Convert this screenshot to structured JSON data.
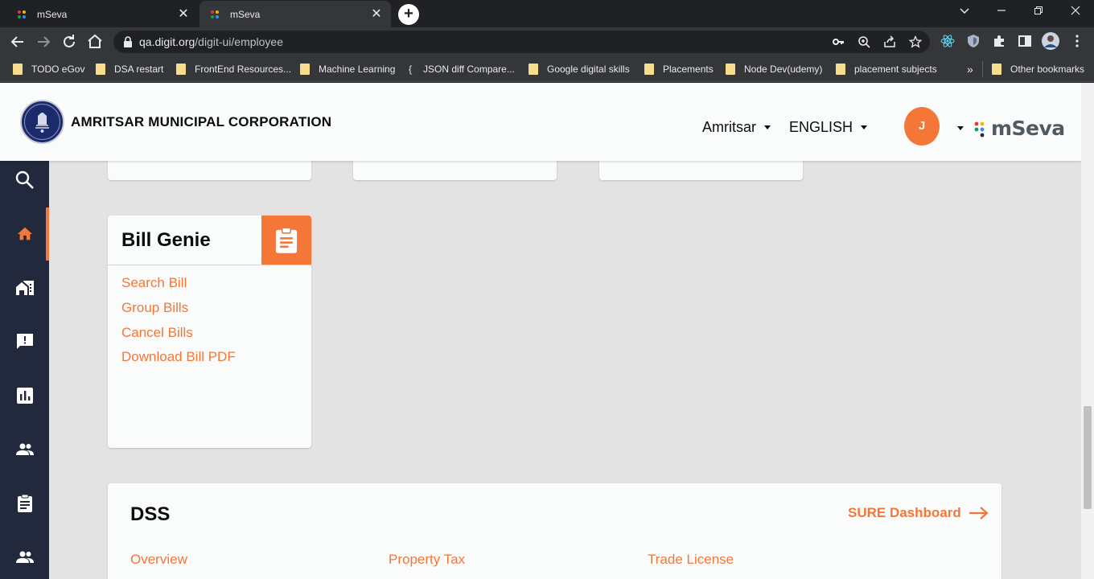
{
  "browser": {
    "tabs": [
      {
        "title": "mSeva",
        "close": "✕"
      },
      {
        "title": "mSeva",
        "close": "✕"
      }
    ],
    "new_tab": "+",
    "window_controls": {
      "minimize": "—",
      "restore": "❐",
      "close": "✕",
      "tablist": "⌄"
    },
    "url_host": "qa.digit.org",
    "url_path": "/digit-ui/employee",
    "bookmarks": [
      {
        "label": "TODO eGov",
        "icon": "folder-icon"
      },
      {
        "label": "DSA restart",
        "icon": "folder-icon"
      },
      {
        "label": "FrontEnd Resources...",
        "icon": "folder-icon"
      },
      {
        "label": "Machine Learning",
        "icon": "folder-icon"
      },
      {
        "label": "JSON diff Compare...",
        "icon": "brace-icon"
      },
      {
        "label": "Google digital skills",
        "icon": "folder-icon"
      },
      {
        "label": "Placements",
        "icon": "folder-icon"
      },
      {
        "label": "Node Dev(udemy)",
        "icon": "folder-icon"
      },
      {
        "label": "placement subjects",
        "icon": "folder-icon"
      }
    ],
    "bookmarks_overflow": "»",
    "other_bookmarks": "Other bookmarks",
    "brace_glyph": "{"
  },
  "header": {
    "org_name": "AMRITSAR MUNICIPAL CORPORATION",
    "city": "Amritsar",
    "language": "ENGLISH",
    "avatar_initial": "J",
    "brand": "mSeva"
  },
  "bill_genie": {
    "title": "Bill Genie",
    "links": [
      "Search Bill",
      "Group Bills",
      "Cancel Bills",
      "Download Bill PDF"
    ]
  },
  "dss": {
    "title": "DSS",
    "sure_dashboard": "SURE Dashboard",
    "links": [
      "Overview",
      "Property Tax",
      "Trade License"
    ]
  },
  "colors": {
    "accent": "#f47738",
    "sidebar": "#22293d",
    "page_bg": "#e3e3e3",
    "card_bg": "#fafcfc"
  }
}
